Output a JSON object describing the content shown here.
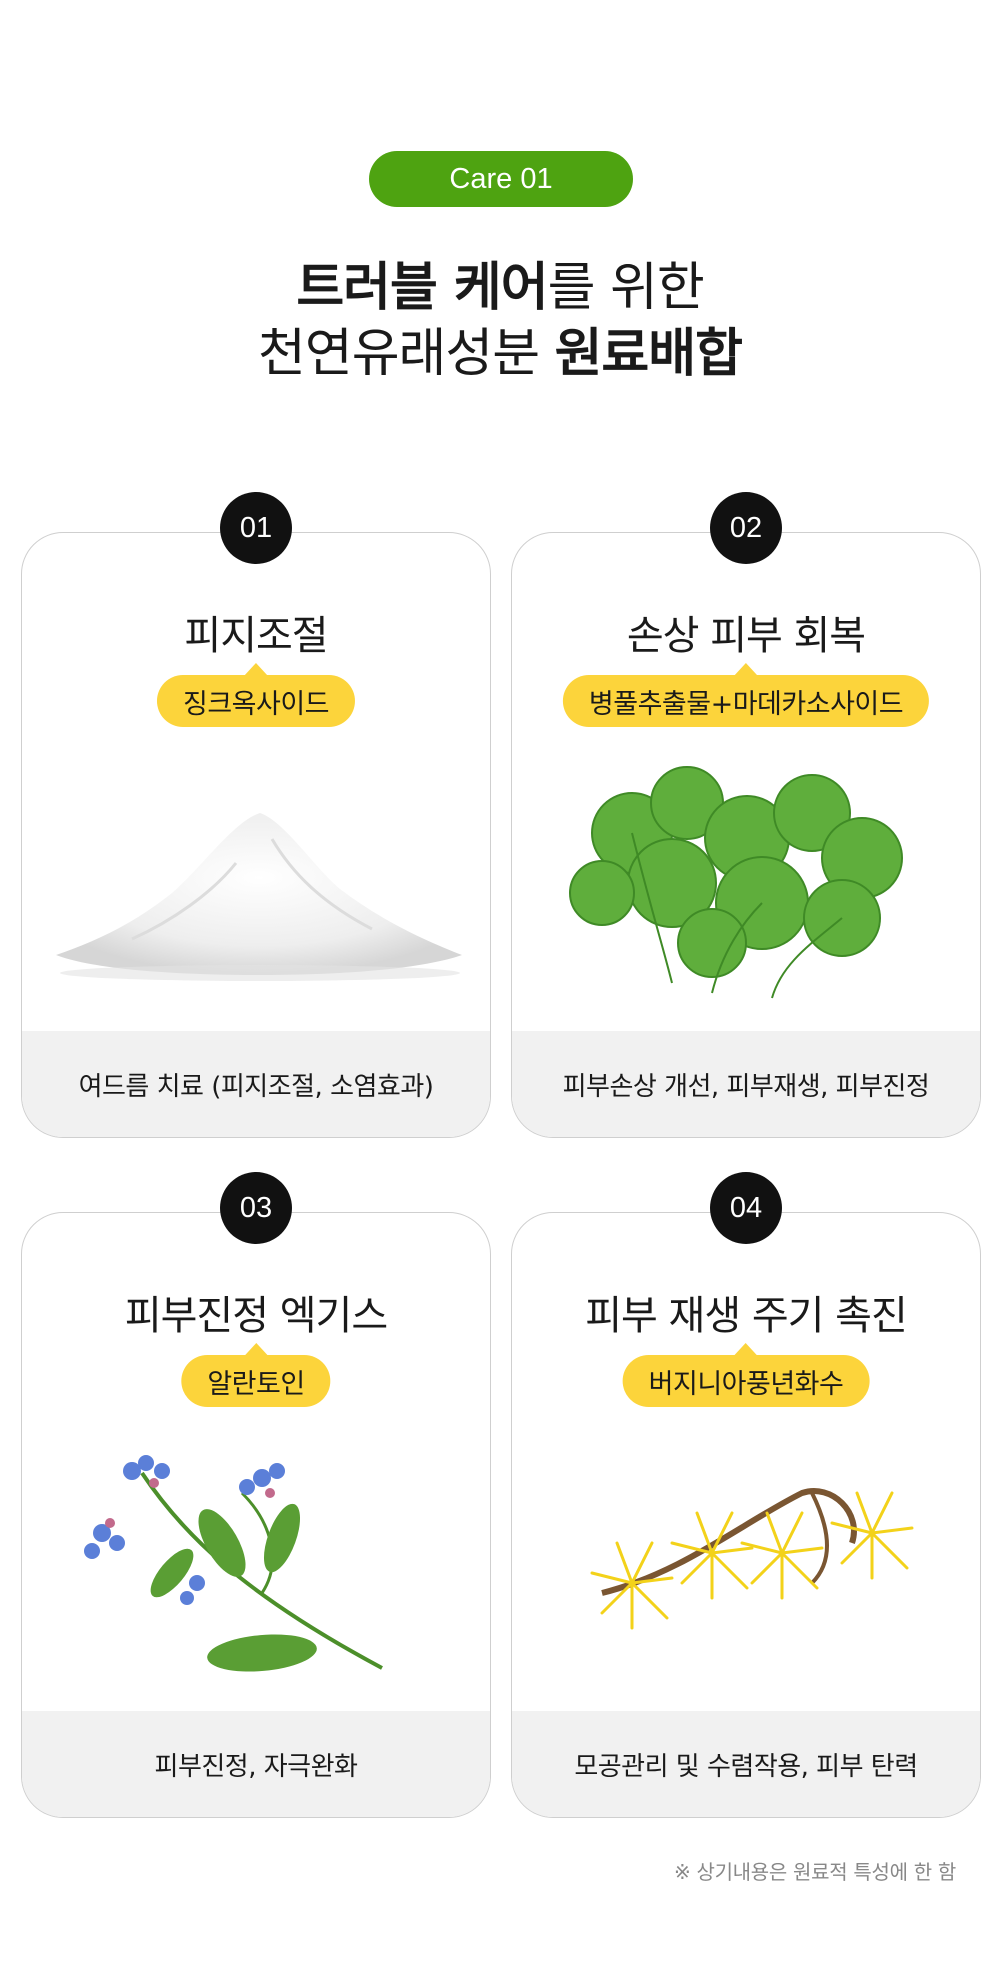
{
  "badge": "Care 01",
  "heading": {
    "line1_bold": "트러블 케어",
    "line1_light": "를 위한",
    "line2_light": "천연유래성분 ",
    "line2_bold": "원료배합"
  },
  "cards": [
    {
      "num": "01",
      "title": "피지조절",
      "tag": "징크옥사이드",
      "desc": "여드름 치료 (피지조절, 소염효과)",
      "image": "white-powder"
    },
    {
      "num": "02",
      "title": "손상 피부 회복",
      "tag": "병풀추출물+마데카소사이드",
      "desc": "피부손상 개선, 피부재생, 피부진정",
      "image": "centella-leaves"
    },
    {
      "num": "03",
      "title": "피부진정 엑기스",
      "tag": "알란토인",
      "desc": "피부진정, 자극완화",
      "image": "comfrey-flower"
    },
    {
      "num": "04",
      "title": "피부 재생 주기 촉진",
      "tag": "버지니아풍년화수",
      "desc": "모공관리 및 수렴작용, 피부 탄력",
      "image": "witch-hazel-flower"
    }
  ],
  "footnote": "※ 상기내용은 원료적 특성에 한 함",
  "colors": {
    "badge": "#4ea311",
    "tag": "#fcd43b",
    "number": "#111111",
    "footer": "#f1f1f1"
  }
}
